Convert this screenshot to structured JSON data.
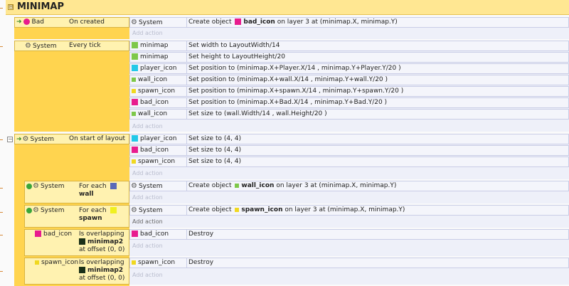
{
  "group": {
    "title": "MINIMAP",
    "toggle": "⊟"
  },
  "add_action": "Add action",
  "events": {
    "e1": {
      "obj": "Bad",
      "trigger": "On created",
      "actions": [
        {
          "obj": "System",
          "text_pre": "Create object",
          "target": "bad_icon",
          "text_post": "on layer 3 at (minimap.X, minimap.Y)"
        }
      ]
    },
    "e2": {
      "obj": "System",
      "trigger": "Every tick",
      "actions": [
        {
          "obj": "minimap",
          "text": "Set width to LayoutWidth/14"
        },
        {
          "obj": "minimap",
          "text": "Set height to LayoutHeight/20"
        },
        {
          "obj": "player_icon",
          "text": "Set position to (minimap.X+Player.X/14 , minimap.Y+Player.Y/20 )"
        },
        {
          "obj": "wall_icon",
          "text": "Set position to (minimap.X+wall.X/14 , minimap.Y+wall.Y/20 )"
        },
        {
          "obj": "spawn_icon",
          "text": "Set position to (minimap.X+spawn.X/14 , minimap.Y+spawn.Y/20 )"
        },
        {
          "obj": "bad_icon",
          "text": "Set position to (minimap.X+Bad.X/14 , minimap.Y+Bad.Y/20 )"
        },
        {
          "obj": "wall_icon",
          "text": "Set size to (wall.Width/14 , wall.Height/20 )"
        }
      ]
    },
    "e3": {
      "obj": "System",
      "trigger": "On start of layout",
      "actions": [
        {
          "obj": "player_icon",
          "text": "Set size to (4, 4)"
        },
        {
          "obj": "bad_icon",
          "text": "Set size to (4, 4)"
        },
        {
          "obj": "spawn_icon",
          "text": "Set size to (4, 4)"
        }
      ]
    },
    "e4": {
      "obj": "System",
      "trigger": "For each",
      "target": "wall",
      "actions": [
        {
          "obj": "System",
          "text_pre": "Create object",
          "target": "wall_icon",
          "text_post": "on layer 3 at (minimap.X, minimap.Y)"
        }
      ]
    },
    "e5": {
      "obj": "System",
      "trigger": "For each",
      "target": "spawn",
      "actions": [
        {
          "obj": "System",
          "text_pre": "Create object",
          "target": "spawn_icon",
          "text_post": "on layer 3 at (minimap.X, minimap.Y)"
        }
      ]
    },
    "e6": {
      "obj": "bad_icon",
      "trigger": "Is overlapping",
      "target": "minimap2",
      "tail": "at offset (0, 0)",
      "actions": [
        {
          "obj": "bad_icon",
          "text": "Destroy"
        }
      ]
    },
    "e7": {
      "obj": "spawn_icon",
      "trigger": "Is overlapping",
      "target": "minimap2",
      "tail": "at offset (0, 0)",
      "actions": [
        {
          "obj": "spawn_icon",
          "text": "Destroy"
        }
      ]
    }
  },
  "colors": {
    "bad": "#e81c8e",
    "minimap": "#7ec84a",
    "player": "#22c8e8",
    "wall": "#5a6ab8",
    "spawn": "#f0d820",
    "minimap2": "#1a3018",
    "wall_icon": "#7ec84a"
  }
}
